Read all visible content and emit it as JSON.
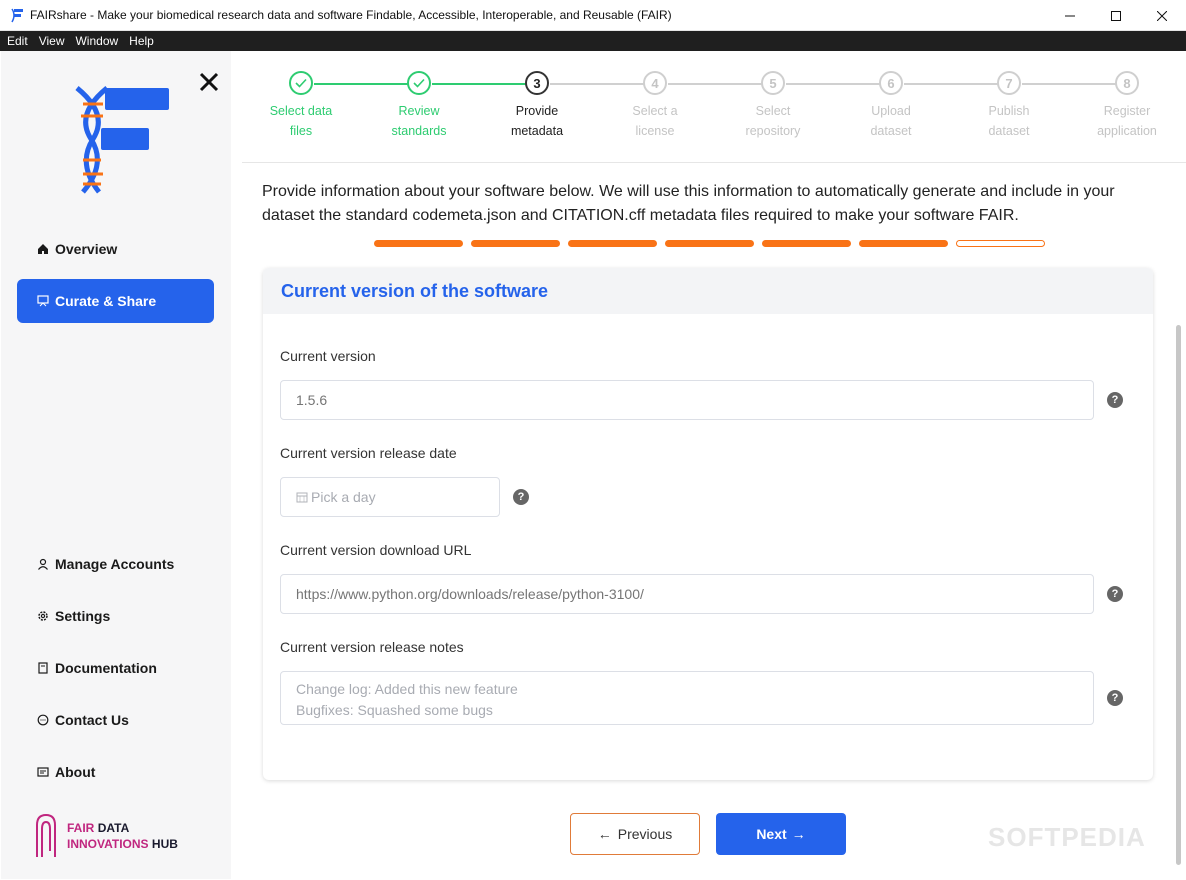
{
  "window": {
    "title": "FAIRshare - Make your biomedical research data and software Findable, Accessible, Interoperable, and Reusable (FAIR)"
  },
  "menu": [
    "Edit",
    "View",
    "Window",
    "Help"
  ],
  "sidebar": {
    "nav_top": [
      {
        "label": "Overview",
        "icon": "home-icon"
      },
      {
        "label": "Curate & Share",
        "icon": "share-icon",
        "active": true
      }
    ],
    "nav_bottom": [
      {
        "label": "Manage Accounts",
        "icon": "user-icon"
      },
      {
        "label": "Settings",
        "icon": "gear-icon"
      },
      {
        "label": "Documentation",
        "icon": "book-icon"
      },
      {
        "label": "Contact Us",
        "icon": "chat-icon"
      },
      {
        "label": "About",
        "icon": "info-card-icon"
      }
    ],
    "hub": {
      "line1_pink": "FAIR",
      "line1_dark": "DATA",
      "line2_pink": "INNOVATIONS",
      "line2_dark": "HUB"
    }
  },
  "stepper": [
    {
      "number": "1",
      "label1": "Select data",
      "label2": "files",
      "state": "done"
    },
    {
      "number": "2",
      "label1": "Review",
      "label2": "standards",
      "state": "done"
    },
    {
      "number": "3",
      "label1": "Provide",
      "label2": "metadata",
      "state": "active"
    },
    {
      "number": "4",
      "label1": "Select a",
      "label2": "license",
      "state": "todo"
    },
    {
      "number": "5",
      "label1": "Select",
      "label2": "repository",
      "state": "todo"
    },
    {
      "number": "6",
      "label1": "Upload",
      "label2": "dataset",
      "state": "todo"
    },
    {
      "number": "7",
      "label1": "Publish",
      "label2": "dataset",
      "state": "todo"
    },
    {
      "number": "8",
      "label1": "Register",
      "label2": "application",
      "state": "todo"
    }
  ],
  "main": {
    "intro": "Provide information about your software below. We will use this information to automatically generate and include in your dataset the standard codemeta.json and CITATION.cff metadata files required to make your software FAIR.",
    "progress_filled": 6,
    "progress_total": 7,
    "card": {
      "title": "Current version of the software",
      "fields": {
        "version": {
          "label": "Current version",
          "placeholder": "1.5.6"
        },
        "release_date": {
          "label": "Current version release date",
          "placeholder": "Pick a day"
        },
        "download_url": {
          "label": "Current version download URL",
          "placeholder": "https://www.python.org/downloads/release/python-3100/"
        },
        "release_notes": {
          "label": "Current version release notes",
          "placeholder": "Change log: Added this new feature\nBugfixes: Squashed some bugs"
        }
      }
    },
    "buttons": {
      "previous": "Previous",
      "next": "Next",
      "prev_arrow": "←",
      "next_arrow": "→"
    }
  },
  "help_glyph": "?",
  "watermark": "SOFTPEDIA",
  "colors": {
    "accent": "#2563eb",
    "success": "#2ecc71",
    "orange": "#f97316",
    "hub_pink": "#c0267f"
  }
}
